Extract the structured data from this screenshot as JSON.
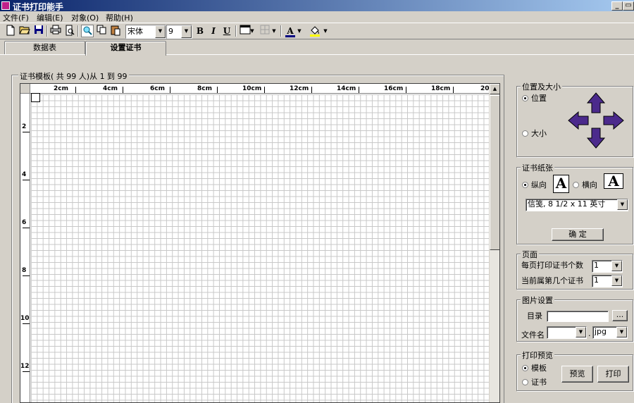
{
  "window": {
    "title": "证书打印能手",
    "minimize_glyph": "_",
    "restore_glyph": "▭"
  },
  "menu": {
    "items": [
      {
        "label": "文件(F)"
      },
      {
        "label": "编辑(E)"
      },
      {
        "label": "对象(O)"
      },
      {
        "label": "帮助(H)"
      }
    ]
  },
  "toolbar": {
    "font_name": "宋体",
    "font_size": "9",
    "bold_label": "B",
    "italic_label": "I",
    "underline_label": "U",
    "font_color_label": "A",
    "font_color": "#000080",
    "fill_color": "#ffff00"
  },
  "tabs": [
    {
      "label": "数据表"
    },
    {
      "label": "设置证书"
    }
  ],
  "template": {
    "caption": "证书模板( 共 99 人)从 1 到 99",
    "ruler_top": [
      "2cm",
      "4cm",
      "6cm",
      "8cm",
      "10cm",
      "12cm",
      "14cm",
      "16cm",
      "18cm",
      "20"
    ],
    "ruler_left": [
      "2",
      "4",
      "6",
      "8",
      "10",
      "12"
    ]
  },
  "position_size": {
    "caption": "位置及大小",
    "position_label": "位置",
    "size_label": "大小",
    "selected": "position",
    "arrow_color": "#4b2a8c"
  },
  "paper": {
    "caption": "证书纸张",
    "portrait_label": "纵向",
    "landscape_label": "横向",
    "orientation_icon_letter": "A",
    "selected": "portrait",
    "paper_size": "信笺, 8 1/2 x 11 英寸",
    "confirm_label": "确 定"
  },
  "page": {
    "caption": "页面",
    "per_page_label": "每页打印证书个数",
    "per_page_value": "1",
    "current_label": "当前属第几个证书",
    "current_value": "1"
  },
  "image_settings": {
    "caption": "图片设置",
    "dir_label": "目录",
    "dir_value": "",
    "browse_label": "...",
    "filename_label": "文件名",
    "filename_value": "",
    "ext_separator": ".",
    "ext_value": "jpg"
  },
  "print_preview": {
    "caption": "打印预览",
    "template_label": "模板",
    "certificate_label": "证书",
    "selected": "template",
    "preview_label": "预览",
    "print_label": "打印"
  }
}
